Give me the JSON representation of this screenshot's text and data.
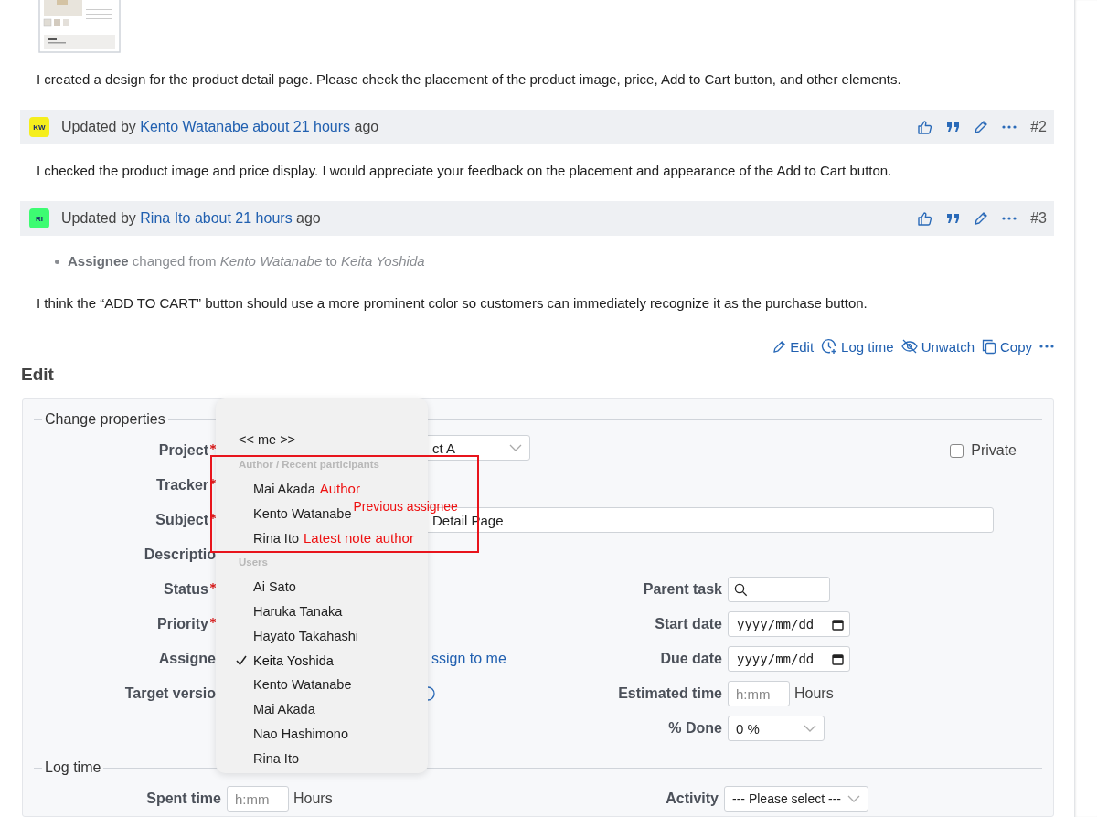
{
  "journal": [
    {
      "kind": "note",
      "text": "I created a design for the product detail page. Please check the placement of the product image, price, Add to Cart button, and other elements."
    },
    {
      "kind": "header",
      "initials": "KW",
      "color": "#f5ee1c",
      "prefix": "Updated by",
      "author": "Kento Watanabe",
      "time": "about 21 hours",
      "suffix": "ago",
      "number": "#2"
    },
    {
      "kind": "note",
      "text": "I checked the product image and price display. I would appreciate your feedback on the placement and appearance of the Add to Cart button."
    },
    {
      "kind": "header",
      "initials": "RI",
      "color": "#3dfc72",
      "prefix": "Updated by",
      "author": "Rina Ito",
      "time": "about 21 hours",
      "suffix": "ago",
      "number": "#3"
    },
    {
      "kind": "change",
      "text": "**Assignee** changed from *Kento Watanabe* to *Keita Yoshida*"
    },
    {
      "kind": "note",
      "text": "I think the “ADD TO CART” button should use a more prominent color so customers can immediately recognize it as the purchase button."
    }
  ],
  "actions": [
    {
      "kind": "edit",
      "label": "Edit"
    },
    {
      "kind": "log",
      "label": "Log time"
    },
    {
      "kind": "unwatch",
      "label": "Unwatch"
    },
    {
      "kind": "copy",
      "label": "Copy"
    }
  ],
  "edit_heading": "Edit",
  "properties": {
    "legend": "Change properties",
    "project": {
      "label": "Project",
      "required": true,
      "value": "ct A"
    },
    "private": {
      "label": "Private",
      "checked": false
    },
    "tracker": {
      "label": "Tracker",
      "required": true
    },
    "subject": {
      "label": "Subject",
      "required": true,
      "value": "Detail Page"
    },
    "description": {
      "label": "Descriptio",
      "required": false
    },
    "left_fields": [
      {
        "label": "Status",
        "required": true,
        "kind": "blank"
      },
      {
        "label": "Priority",
        "required": true,
        "kind": "blank"
      },
      {
        "label": "Assigne",
        "required": false,
        "kind": "link",
        "link": "ssign to me"
      },
      {
        "label": "Target versio",
        "required": false,
        "kind": "add"
      }
    ],
    "right_fields": [
      {
        "label": "Parent task",
        "kind": "search"
      },
      {
        "label": "Start date",
        "kind": "date",
        "placeholder": "yyyy/mm/dd"
      },
      {
        "label": "Due date",
        "kind": "date",
        "placeholder": "yyyy/mm/dd"
      },
      {
        "label": "Estimated time",
        "kind": "hours",
        "placeholder": "h:mm",
        "unit": "Hours"
      },
      {
        "label": "% Done",
        "kind": "select",
        "value": "0 %"
      }
    ]
  },
  "log_time": {
    "legend": "Log time",
    "spent": {
      "label": "Spent time",
      "placeholder": "h:mm",
      "unit": "Hours"
    },
    "activity": {
      "label": "Activity",
      "value": "--- Please select ---"
    }
  },
  "dropdown": {
    "me": "<< me >>",
    "groups": [
      {
        "label": "Author / Recent participants",
        "highlighted": true,
        "items": [
          {
            "name": "Mai Akada",
            "selected": false,
            "note": "Author"
          },
          {
            "name": "Kento Watanabe",
            "selected": false,
            "note": "Previous assignee"
          },
          {
            "name": "Rina Ito",
            "selected": false,
            "note": "Latest note author"
          }
        ]
      },
      {
        "label": "Users",
        "highlighted": false,
        "items": [
          {
            "name": "Ai Sato",
            "selected": false
          },
          {
            "name": "Haruka Tanaka",
            "selected": false
          },
          {
            "name": "Hayato Takahashi",
            "selected": false
          },
          {
            "name": "Keita Yoshida",
            "selected": true
          },
          {
            "name": "Kento Watanabe",
            "selected": false
          },
          {
            "name": "Mai Akada",
            "selected": false
          },
          {
            "name": "Nao Hashimono",
            "selected": false
          },
          {
            "name": "Rina Ito",
            "selected": false
          }
        ]
      }
    ]
  }
}
